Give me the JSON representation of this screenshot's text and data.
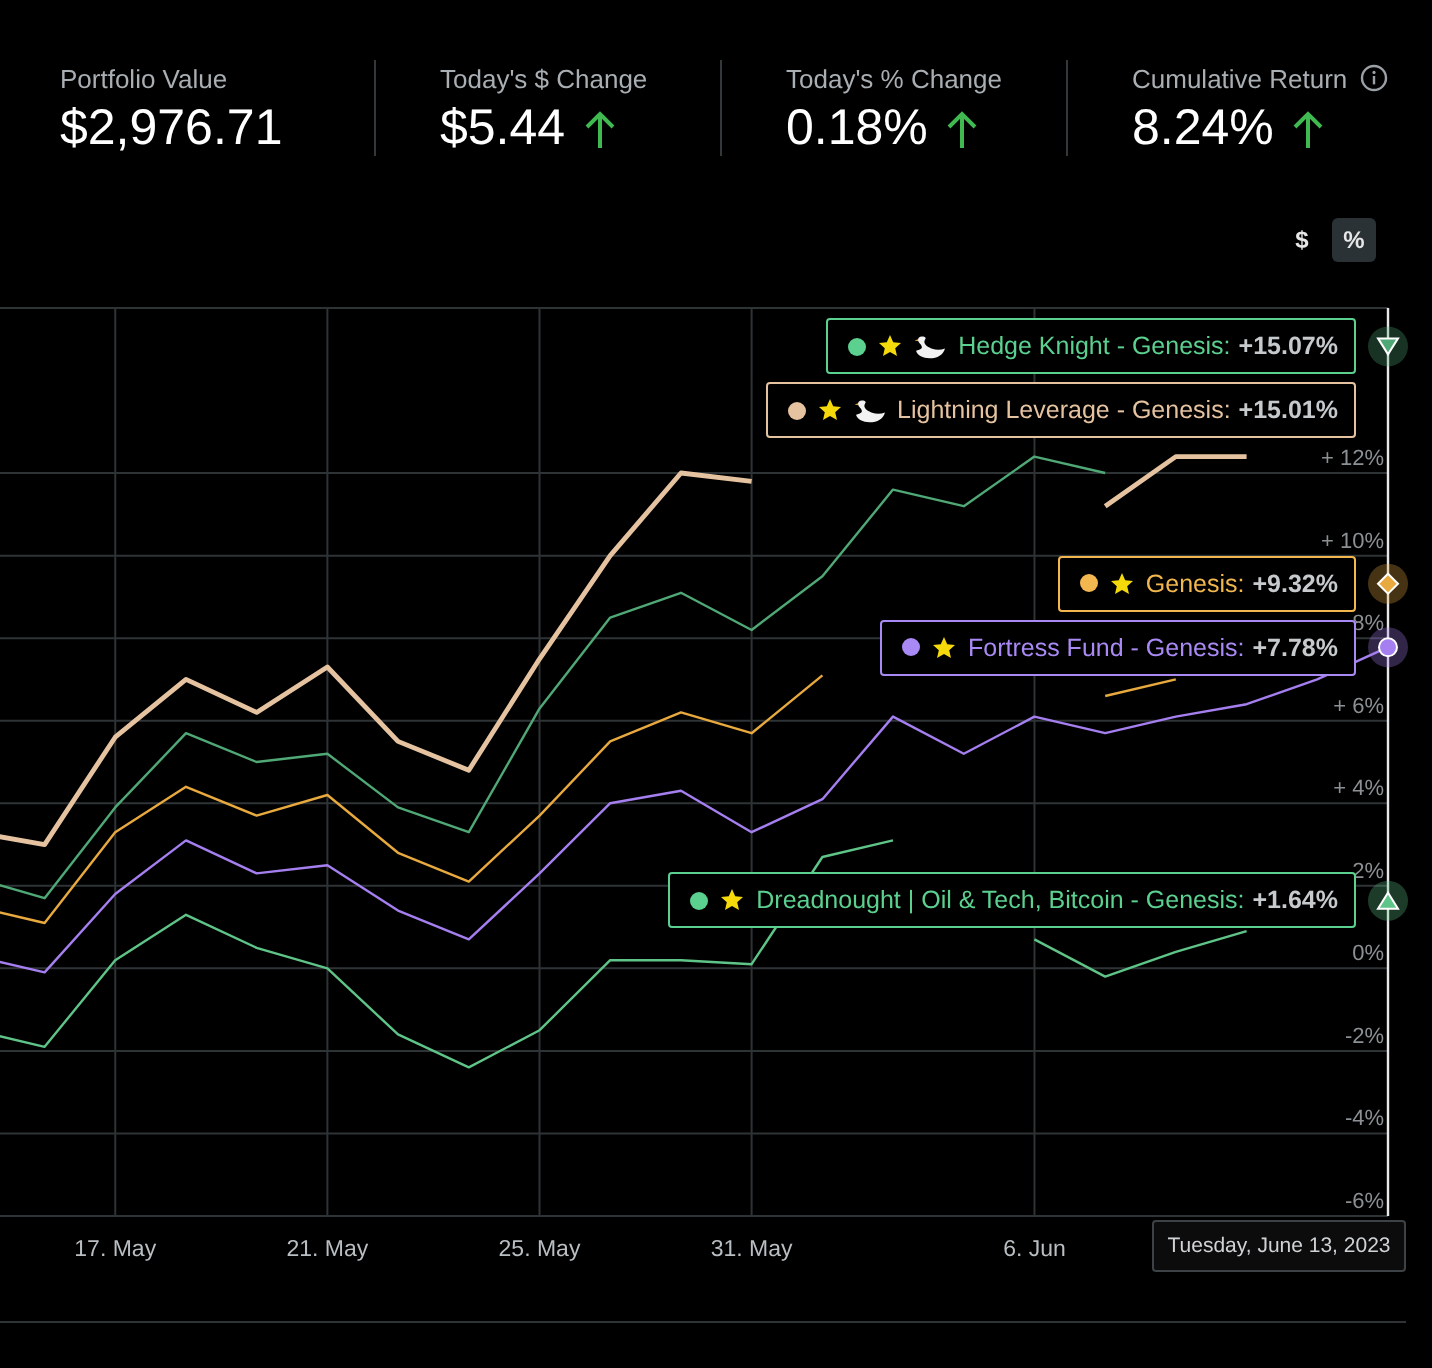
{
  "summary": [
    {
      "label": "Portfolio Value",
      "value": "$2,976.71",
      "rising": false,
      "info": false
    },
    {
      "label": "Today's $ Change",
      "value": "$5.44",
      "rising": true,
      "info": false
    },
    {
      "label": "Today's % Change",
      "value": "0.18%",
      "rising": true,
      "info": false
    },
    {
      "label": "Cumulative Return",
      "value": "8.24%",
      "rising": true,
      "info": true
    }
  ],
  "units_toggle": [
    {
      "label": "$",
      "selected": false
    },
    {
      "label": "%",
      "selected": true
    }
  ],
  "chart": {
    "chart_data": {
      "type": "line",
      "categories": [
        null,
        null,
        "17. May",
        null,
        null,
        "21. May",
        null,
        null,
        "25. May",
        null,
        null,
        "31. May",
        null,
        null,
        null,
        "6. Jun",
        null,
        null,
        null,
        null,
        null
      ],
      "ylim": [
        -6,
        16
      ],
      "grid": true,
      "yticks": [
        {
          "value": 12,
          "label": "+ 12%"
        },
        {
          "value": 10,
          "label": "+ 10%"
        },
        {
          "value": 8,
          "label": "8%"
        },
        {
          "value": 6,
          "label": "+ 6%"
        },
        {
          "value": 4,
          "label": "+ 4%"
        },
        {
          "value": 2,
          "label": "2%"
        },
        {
          "value": 0,
          "label": "0%"
        },
        {
          "value": -2,
          "label": "-2%"
        },
        {
          "value": -4,
          "label": "-4%"
        },
        {
          "value": -6,
          "label": "-6%"
        }
      ],
      "series": [
        {
          "color": "#4fa876",
          "values": [
            2.2,
            1.7,
            3.9,
            5.7,
            5.0,
            5.2,
            3.9,
            3.3,
            6.3,
            8.5,
            9.1,
            8.2,
            9.5,
            11.6,
            11.2,
            12.4,
            12.0,
            null,
            null,
            null,
            15.07
          ]
        },
        {
          "color": "#e6c3a0",
          "values": [
            3.3,
            3.0,
            5.6,
            7.0,
            6.2,
            7.3,
            5.5,
            4.8,
            7.5,
            10.0,
            12.0,
            11.8,
            null,
            null,
            null,
            null,
            11.2,
            12.4,
            12.4,
            null,
            null
          ]
        },
        {
          "color": "#e8a93e",
          "values": [
            1.5,
            1.1,
            3.3,
            4.4,
            3.7,
            4.2,
            2.8,
            2.1,
            3.7,
            5.5,
            6.2,
            5.7,
            7.1,
            null,
            null,
            null,
            6.6,
            7.0,
            null,
            null,
            9.32
          ]
        },
        {
          "color": "#a57ff0",
          "values": [
            0.3,
            -0.1,
            1.8,
            3.1,
            2.3,
            2.5,
            1.4,
            0.7,
            2.3,
            4.0,
            4.3,
            3.3,
            4.1,
            6.1,
            5.2,
            6.1,
            5.7,
            6.1,
            6.4,
            7.0,
            7.78
          ]
        },
        {
          "color": "#5fc488",
          "values": [
            -1.5,
            -1.9,
            0.2,
            1.3,
            0.5,
            0.0,
            -1.6,
            -2.4,
            -1.5,
            0.2,
            0.2,
            0.1,
            2.7,
            3.1,
            null,
            0.7,
            -0.2,
            0.4,
            0.9,
            null,
            1.64
          ]
        }
      ]
    },
    "line_styles": [
      {
        "highlighted": false
      },
      {
        "highlighted": true
      },
      {
        "highlighted": false
      },
      {
        "highlighted": false
      },
      {
        "highlighted": false
      }
    ],
    "tooltips": [
      {
        "label": "Hedge Knight - Genesis:",
        "value": "+15.07%",
        "color": "#5bd08f",
        "swan": true,
        "kind": "down"
      },
      {
        "label": "Lightning Leverage - Genesis:",
        "value": "+15.01%",
        "color": "#e6c3a0",
        "swan": true,
        "kind": "hidden"
      },
      {
        "label": "Genesis:",
        "value": "+9.32%",
        "color": "#f2b74f",
        "swan": false,
        "kind": "diamond"
      },
      {
        "label": "Fortress Fund - Genesis:",
        "value": "+7.78%",
        "color": "#a98af5",
        "swan": false,
        "kind": "circle"
      },
      {
        "label": "Dreadnought | Oil & Tech, Bitcoin - Genesis:",
        "value": "+1.64%",
        "color": "#5bd08f",
        "swan": false,
        "kind": "up"
      }
    ],
    "crosshair_label": "Tuesday, June 13, 2023"
  }
}
